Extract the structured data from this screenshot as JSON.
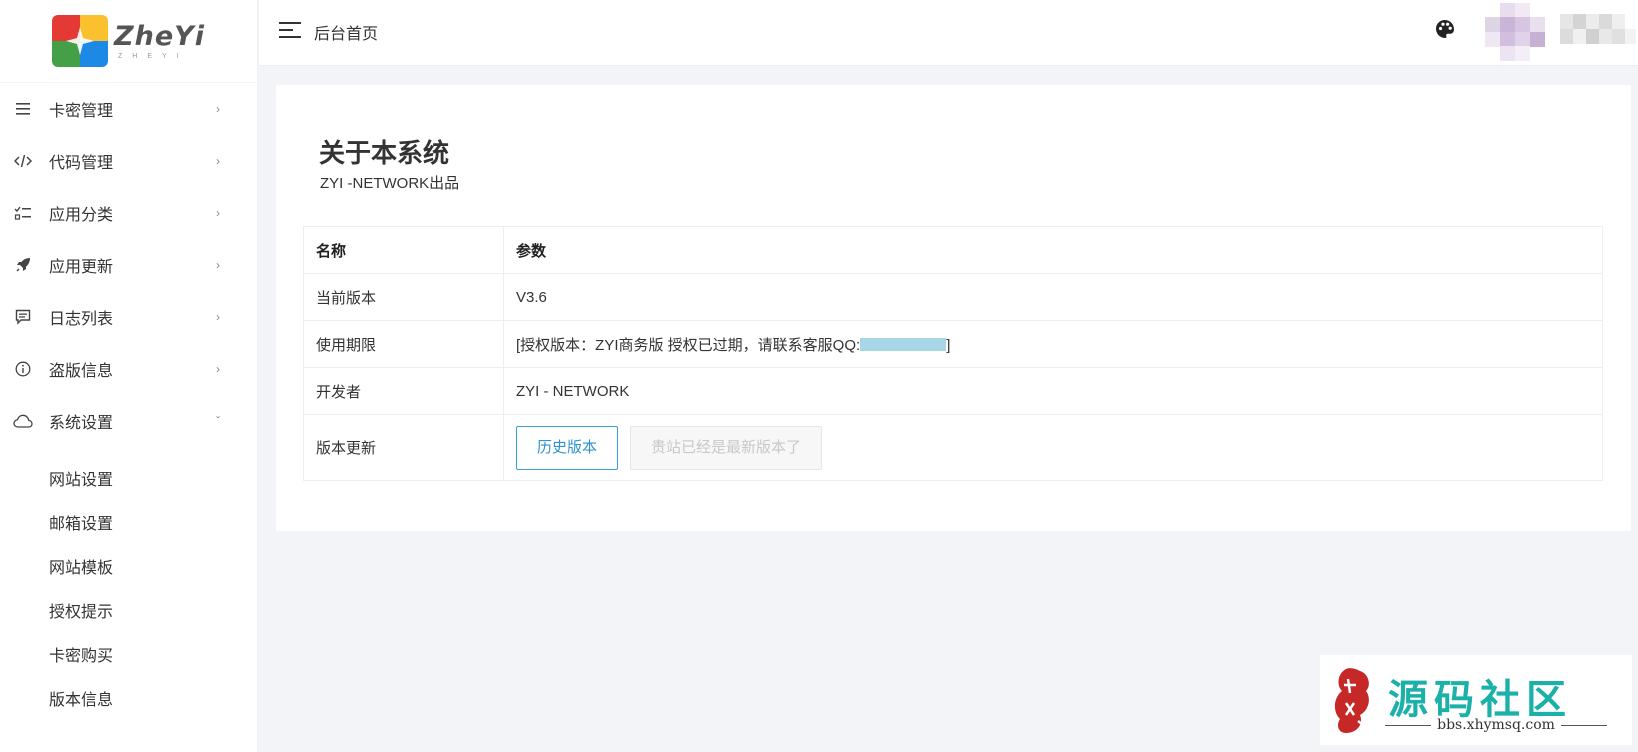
{
  "brand": {
    "name": "ZheYi",
    "sub": "ZHEYI"
  },
  "header": {
    "title": "后台首页"
  },
  "sidebar": {
    "items": [
      {
        "label": "卡密管理",
        "icon": "list-icon"
      },
      {
        "label": "代码管理",
        "icon": "code-icon"
      },
      {
        "label": "应用分类",
        "icon": "checklist-icon"
      },
      {
        "label": "应用更新",
        "icon": "rocket-icon"
      },
      {
        "label": "日志列表",
        "icon": "message-icon"
      },
      {
        "label": "盗版信息",
        "icon": "info-icon"
      },
      {
        "label": "系统设置",
        "icon": "cloud-icon"
      }
    ],
    "submenu": [
      "网站设置",
      "邮箱设置",
      "网站模板",
      "授权提示",
      "卡密购买",
      "版本信息"
    ]
  },
  "main": {
    "title": "关于本系统",
    "subtitle": "ZYI -NETWORK出品",
    "table": {
      "headers": [
        "名称",
        "参数"
      ],
      "rows": [
        {
          "name": "当前版本",
          "value": "V3.6"
        },
        {
          "name": "使用期限",
          "value_prefix": "[授权版本：ZYI商务版 授权已过期，请联系客服QQ:",
          "value_suffix": "]"
        },
        {
          "name": "开发者",
          "value": "ZYI - NETWORK"
        },
        {
          "name": "版本更新"
        }
      ]
    },
    "buttons": {
      "history": "历史版本",
      "latest": "贵站已经是最新版本了"
    }
  },
  "watermark": {
    "title": "源码社区",
    "url": "bbs.xhymsq.com"
  },
  "colors": {
    "accent": "#2e93cf",
    "watermark": "#1bb0a8",
    "redaction": "#a8d6e6"
  }
}
